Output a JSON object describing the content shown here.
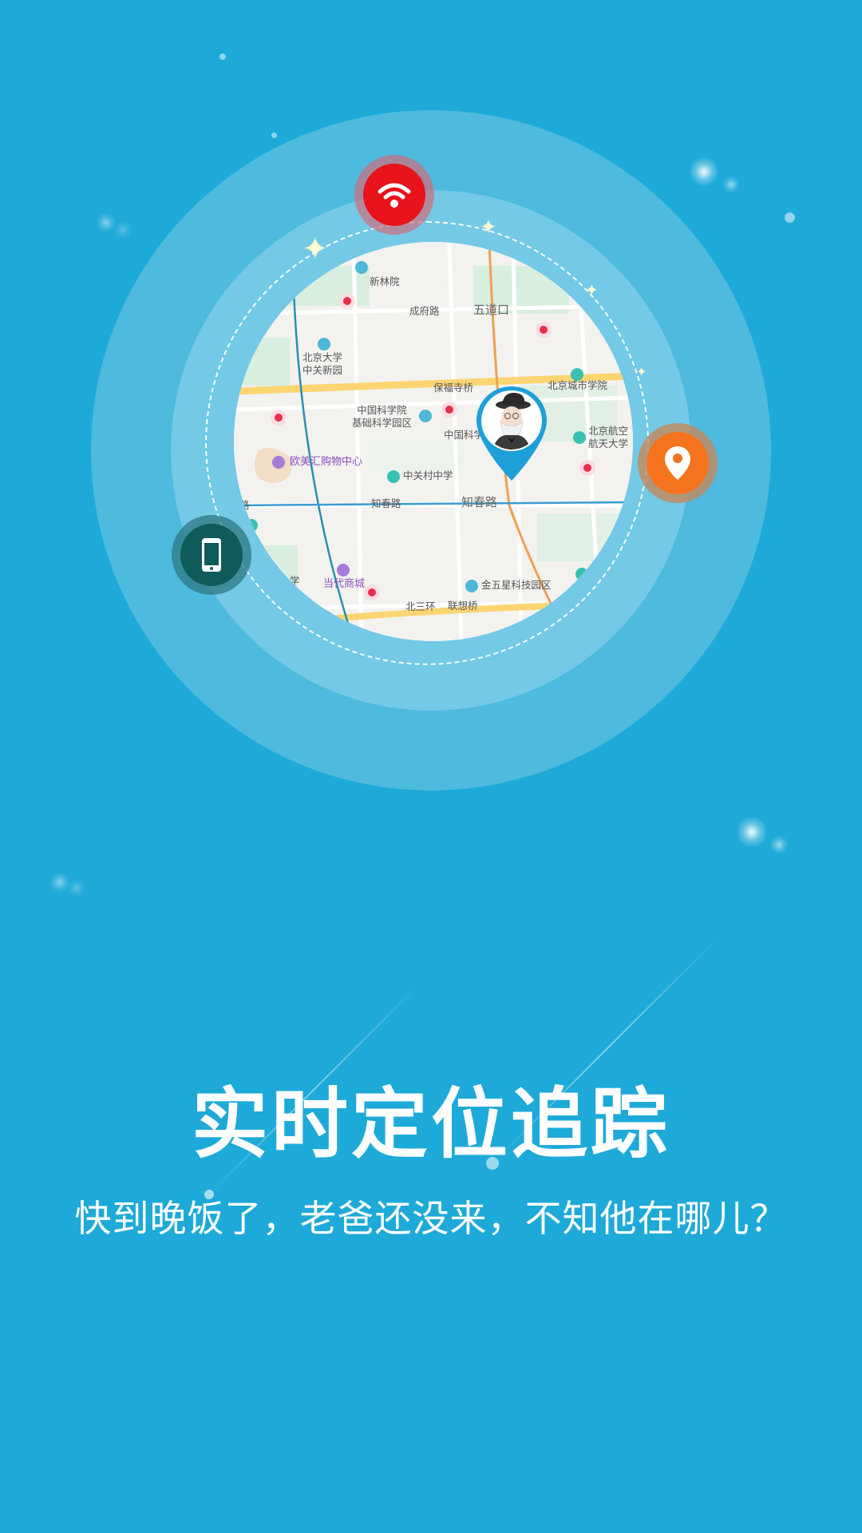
{
  "colors": {
    "background": "#1eaad8",
    "halo_outer": "#4dbade",
    "halo_mid": "#73c9e6",
    "wifi_badge": "#e8131b",
    "location_badge": "#f5731c",
    "phone_badge": "#0f5b5b",
    "pin": "#1e9fd8"
  },
  "icons": {
    "wifi": "wifi-icon",
    "location": "location-pin-icon",
    "phone": "smartphone-icon",
    "avatar": "grandfather-avatar"
  },
  "map": {
    "labels": {
      "xinlinyuan": "新林院",
      "chengfu_road": "成府路",
      "wudaokou": "五道口",
      "pku_zhongguan": "北京大学\n中关新园",
      "baofusi_bridge": "保福寺桥",
      "bj_city_college": "北京城市学院",
      "cas_base": "中国科学院\n基础科学园区",
      "cas_short": "中国科学",
      "buaa": "北京航空\n航天大学",
      "oumeihui": "欧美汇购物中心",
      "zgc_middle": "中关村中学",
      "road_left": "路",
      "zhichun_small": "知春路",
      "zhichun_big": "知春路",
      "school_left": "学",
      "dangdai": "当代商城",
      "jinwuxing": "金五星科技园区",
      "north_3rd_ring": "北三环",
      "lianxiang_bridge": "联想桥"
    }
  },
  "headline": "实时定位追踪",
  "subline": "快到晚饭了，老爸还没来，不知他在哪儿？"
}
